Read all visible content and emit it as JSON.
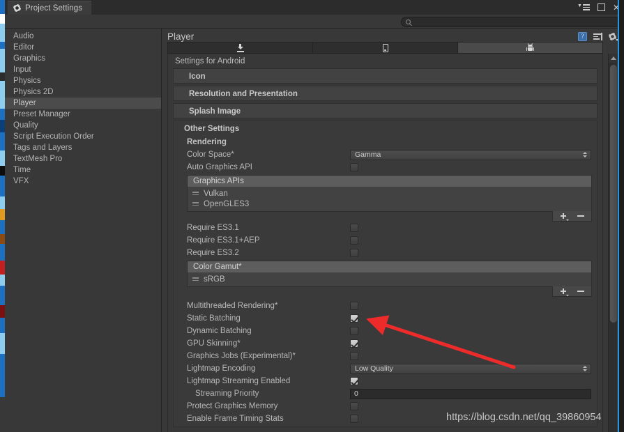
{
  "window": {
    "tab_label": "Project Settings",
    "gear_icon": "gear-icon",
    "menu_icon": "window-menu-icon",
    "maximize_icon": "maximize-icon",
    "close_icon": "close-icon",
    "close_glyph": "✕"
  },
  "search": {
    "value": "",
    "placeholder": "",
    "icon": "search-icon"
  },
  "sidebar": {
    "items": [
      {
        "label": "Audio",
        "selected": false
      },
      {
        "label": "Editor",
        "selected": false
      },
      {
        "label": "Graphics",
        "selected": false
      },
      {
        "label": "Input",
        "selected": false
      },
      {
        "label": "Physics",
        "selected": false
      },
      {
        "label": "Physics 2D",
        "selected": false
      },
      {
        "label": "Player",
        "selected": true
      },
      {
        "label": "Preset Manager",
        "selected": false
      },
      {
        "label": "Quality",
        "selected": false
      },
      {
        "label": "Script Execution Order",
        "selected": false
      },
      {
        "label": "Tags and Layers",
        "selected": false
      },
      {
        "label": "TextMesh Pro",
        "selected": false
      },
      {
        "label": "Time",
        "selected": false
      },
      {
        "label": "VFX",
        "selected": false
      }
    ]
  },
  "panel": {
    "title": "Player",
    "icons": [
      {
        "name": "help-book-icon",
        "glyph": "?"
      },
      {
        "name": "preset-lines-icon"
      },
      {
        "name": "gear-dropdown-icon"
      }
    ]
  },
  "platform_tabs": [
    {
      "name": "tab-standalone",
      "icon": "download-arrow-icon",
      "active": false
    },
    {
      "name": "tab-ios",
      "icon": "phone-icon",
      "active": false
    },
    {
      "name": "tab-android",
      "icon": "android-robot-icon",
      "active": true
    }
  ],
  "inspector": {
    "settings_for": "Settings for Android",
    "foldouts": [
      {
        "label": "Icon"
      },
      {
        "label": "Resolution and Presentation"
      },
      {
        "label": "Splash Image"
      }
    ],
    "other_settings": {
      "title": "Other Settings",
      "rendering_title": "Rendering",
      "color_space": {
        "label": "Color Space*",
        "value": "Gamma"
      },
      "auto_graphics_api": {
        "label": "Auto Graphics API",
        "checked": false
      },
      "graphics_apis": {
        "header": "Graphics APIs",
        "items": [
          "Vulkan",
          "OpenGLES3"
        ]
      },
      "require_rows": [
        {
          "label": "Require ES3.1",
          "checked": false
        },
        {
          "label": "Require ES3.1+AEP",
          "checked": false
        },
        {
          "label": "Require ES3.2",
          "checked": false
        }
      ],
      "color_gamut": {
        "header": "Color Gamut*",
        "items": [
          "sRGB"
        ]
      },
      "rows": [
        {
          "label": "Multithreaded Rendering*",
          "type": "checkbox",
          "checked": false
        },
        {
          "label": "Static Batching",
          "type": "checkbox",
          "checked": true
        },
        {
          "label": "Dynamic Batching",
          "type": "checkbox",
          "checked": false
        },
        {
          "label": "GPU Skinning*",
          "type": "checkbox",
          "checked": true
        },
        {
          "label": "Graphics Jobs (Experimental)*",
          "type": "checkbox",
          "checked": false
        },
        {
          "label": "Lightmap Encoding",
          "type": "dropdown",
          "value": "Low Quality"
        },
        {
          "label": "Lightmap Streaming Enabled",
          "type": "checkbox",
          "checked": true
        },
        {
          "label": "Streaming Priority",
          "type": "textfield",
          "value": "0",
          "indent": true
        },
        {
          "label": "Protect Graphics Memory",
          "type": "checkbox",
          "checked": false
        },
        {
          "label": "Enable Frame Timing Stats",
          "type": "checkbox",
          "checked": false
        }
      ]
    },
    "list_buttons": {
      "add": "+",
      "remove": "−"
    }
  },
  "annotation": {
    "color": "#ee2b2b",
    "target": "Multithreaded Rendering* checkbox"
  },
  "watermark": "https://blog.csdn.net/qq_39860954",
  "colors": {
    "window_bg": "#383838",
    "panel_bg": "#3a3a3a",
    "selection": "#4b4b4b",
    "accent_blue": "#2b94e0",
    "text": "#b8b8b8"
  }
}
